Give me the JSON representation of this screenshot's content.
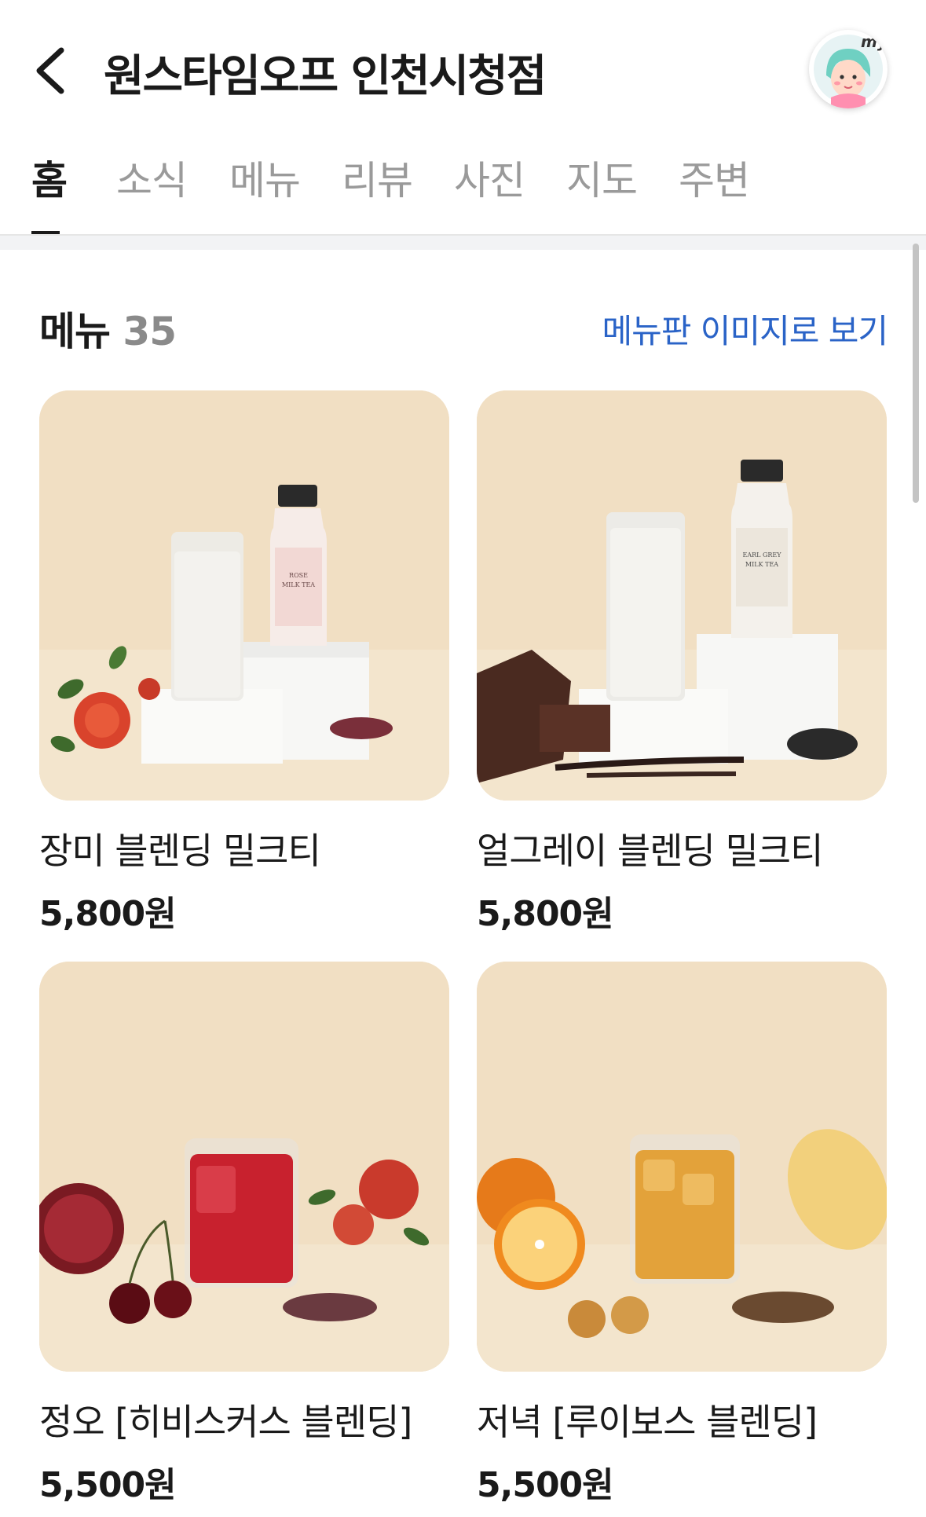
{
  "header": {
    "title": "원스타임오프 인천시청점",
    "back_icon": "chevron-left-icon",
    "avatar_label": "my"
  },
  "tabs": [
    {
      "label": "홈",
      "active": true
    },
    {
      "label": "소식",
      "active": false
    },
    {
      "label": "메뉴",
      "active": false
    },
    {
      "label": "리뷰",
      "active": false
    },
    {
      "label": "사진",
      "active": false
    },
    {
      "label": "지도",
      "active": false
    },
    {
      "label": "주변",
      "active": false
    }
  ],
  "menu_section": {
    "title": "메뉴",
    "count": "35",
    "link": "메뉴판 이미지로 보기"
  },
  "menu_items": [
    {
      "name": "장미 블렌딩 밀크티",
      "price": "5,800원",
      "bottle_label": "ROSE MILK TEA"
    },
    {
      "name": "얼그레이 블렌딩 밀크티",
      "price": "5,800원",
      "bottle_label": "EARL GREY MILK TEA"
    },
    {
      "name": "정오 [히비스커스 블렌딩]",
      "price": "5,500원"
    },
    {
      "name": "저녁 [루이보스 블렌딩]",
      "price": "5,500원"
    }
  ],
  "colors": {
    "accent_link": "#2a63c7",
    "active_tab": "#1a1a1a",
    "inactive_tab": "#9a9a9a",
    "photo_bg": "#f3e4cc"
  }
}
